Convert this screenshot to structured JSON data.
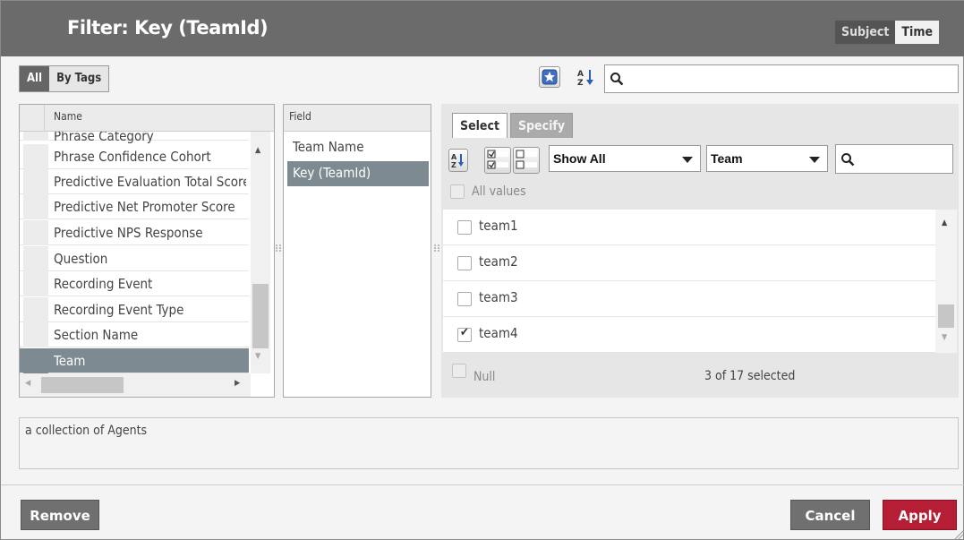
{
  "header": {
    "title": "Filter: Key (TeamId)",
    "tabs": [
      {
        "label": "Subject"
      },
      {
        "label": "Time"
      }
    ]
  },
  "left_toolbar": {
    "toggles": [
      {
        "label": "All"
      },
      {
        "label": "By Tags"
      }
    ]
  },
  "top_search": {
    "placeholder": "",
    "value": ""
  },
  "name_list": {
    "header": "Name",
    "partial_row": "Phrase Category",
    "items": [
      {
        "label": "Phrase Confidence Cohort"
      },
      {
        "label": "Predictive Evaluation Total Score"
      },
      {
        "label": "Predictive Net Promoter Score"
      },
      {
        "label": "Predictive NPS Response"
      },
      {
        "label": "Question"
      },
      {
        "label": "Recording Event"
      },
      {
        "label": "Recording Event Type"
      },
      {
        "label": "Section Name"
      },
      {
        "label": "Team"
      }
    ],
    "selected": "Team"
  },
  "field_list": {
    "header": "Field",
    "items": [
      {
        "label": "Team Name"
      },
      {
        "label": "Key (TeamId)"
      }
    ],
    "selected": "Key (TeamId)"
  },
  "right_panel": {
    "tabs": [
      {
        "label": "Select"
      },
      {
        "label": "Specify"
      }
    ],
    "show_dropdown": "Show All",
    "field_dropdown": "Team",
    "search": {
      "value": ""
    },
    "all_values_label": "All values",
    "values": [
      {
        "label": "team1",
        "checked": false
      },
      {
        "label": "team2",
        "checked": false
      },
      {
        "label": "team3",
        "checked": false
      },
      {
        "label": "team4",
        "checked": true
      }
    ],
    "null_label": "Null",
    "selection_summary": "3 of 17 selected"
  },
  "description": "a collection of Agents",
  "footer": {
    "remove_label": "Remove",
    "cancel_label": "Cancel",
    "apply_label": "Apply"
  },
  "colors": {
    "header": "#6b6b6b",
    "selected_row": "#7d8a91",
    "apply": "#b51e34"
  }
}
